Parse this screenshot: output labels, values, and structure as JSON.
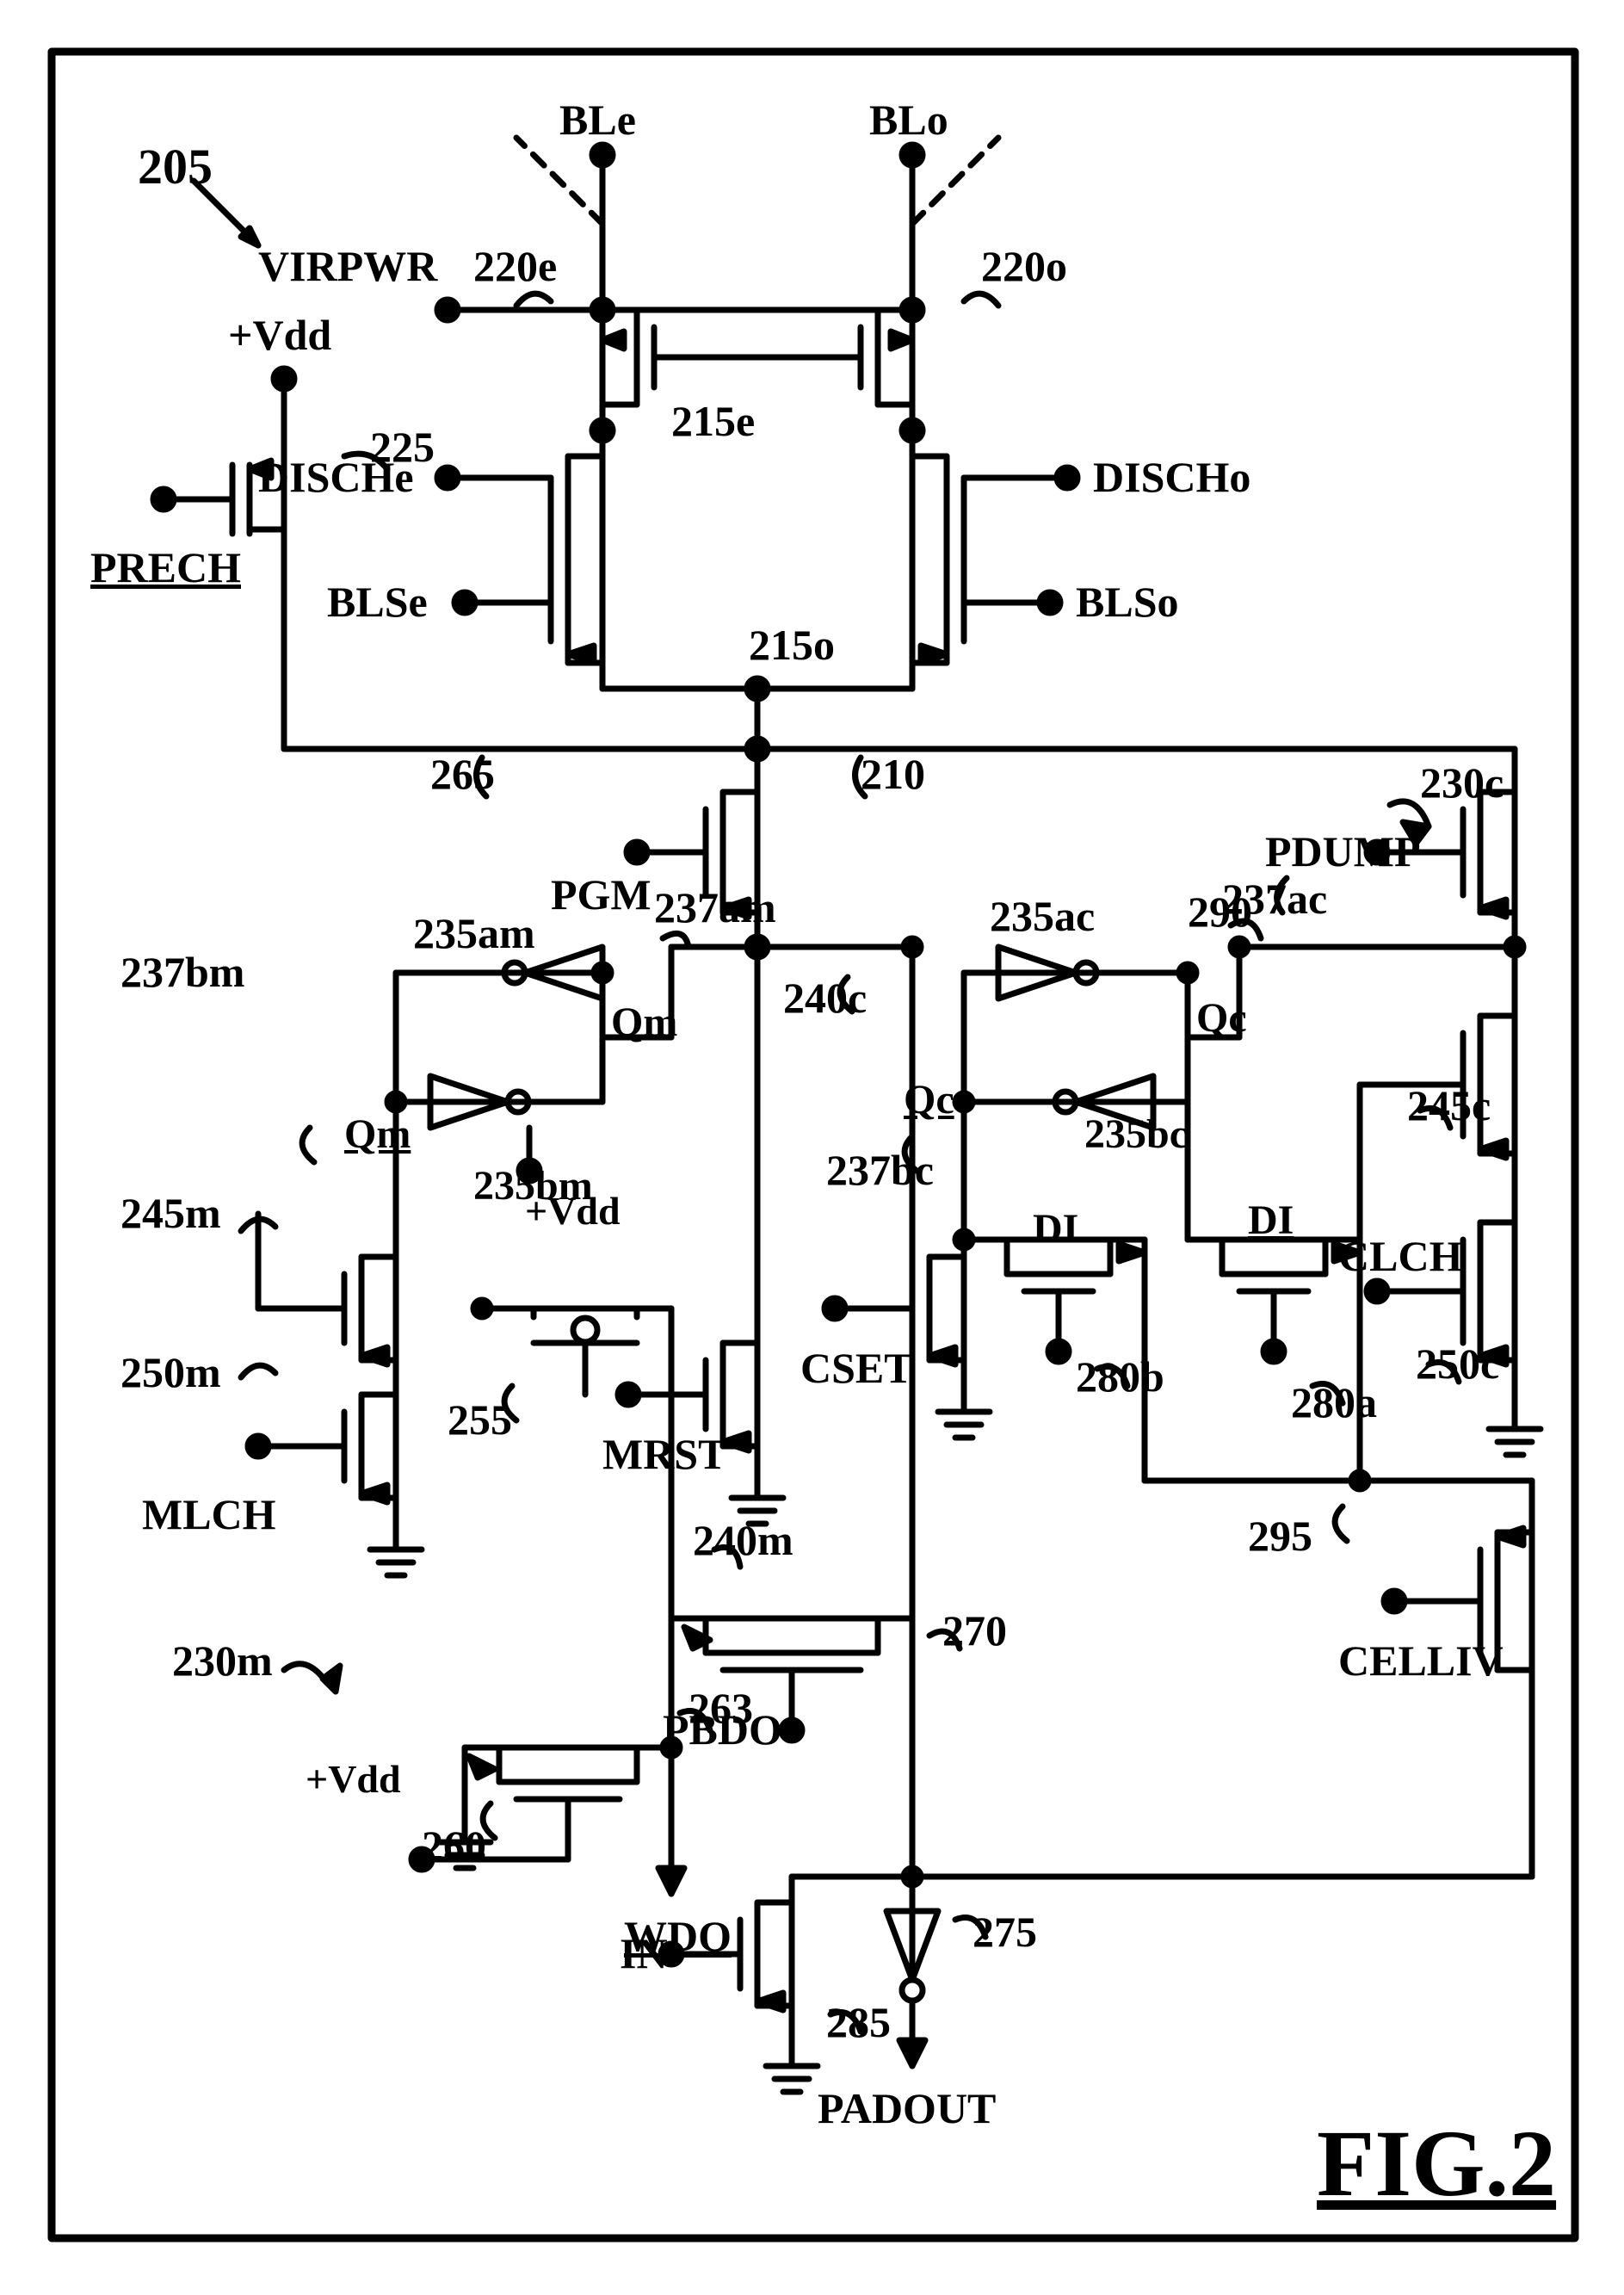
{
  "figure_label": "FIG.2",
  "labels": {
    "n205": "205",
    "vdd1": "+Vdd",
    "prech": "PRECH",
    "n225": "225",
    "ble": "BLe",
    "blo": "BLo",
    "virpwr": "VIRPWR",
    "n220e": "220e",
    "n220o": "220o",
    "n215e": "215e",
    "n215o": "215o",
    "disch_e": "DISCHe",
    "disch_o": "DISCHo",
    "blse": "BLSe",
    "blso": "BLSo",
    "n265": "265",
    "n210": "210",
    "pgm": "PGM",
    "n230m": "230m",
    "n230c": "230c",
    "n237bm": "237bm",
    "n237am": "237am",
    "n235am": "235am",
    "n235bm": "235bm",
    "n235ac": "235ac",
    "n235bc": "235bc",
    "n237ac": "237ac",
    "n237bc": "237bc",
    "qm": "Qm",
    "qm_bar": "Qm",
    "qc": "Qc",
    "qc_bar": "Qc",
    "n240c": "240c",
    "cset": "CSET",
    "di": "DI",
    "di_bar": "DI",
    "n280b": "280b",
    "n280a": "280a",
    "n245c": "245c",
    "clch": "CLCH",
    "n250c": "250c",
    "n290": "290",
    "pdump": "PDUMP",
    "n295": "295",
    "celliv": "CELLIV",
    "vdd2": "+Vdd",
    "n245m": "245m",
    "n250m": "250m",
    "mlch": "MLCH",
    "n255": "255",
    "mrst": "MRST",
    "n240m": "240m",
    "pbdo": "PBDO",
    "n270": "270",
    "n263": "263",
    "vdd3": "+Vdd",
    "n260": "260",
    "wdo": "WDO",
    "in": "IN",
    "n285": "285",
    "n275": "275",
    "padout": "PADOUT"
  }
}
